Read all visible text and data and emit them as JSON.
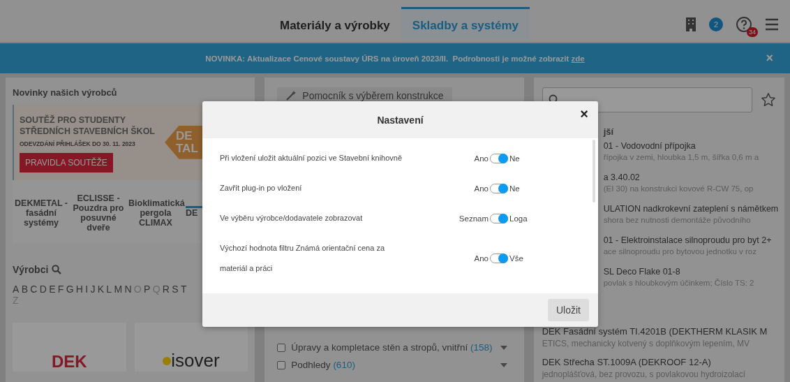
{
  "header": {
    "tabs": [
      {
        "label": "Materiály a výrobky",
        "selected": false
      },
      {
        "label": "Skladby a systémy",
        "selected": true
      }
    ],
    "notification_count": "2",
    "help_count": "34"
  },
  "banner": {
    "text": "NOVINKA: Aktualizace Cenové soustavy ÚRS na úroveň 2023/II.  Podrobnosti je možné zobrazit",
    "link": "zde",
    "close": "×"
  },
  "left_panel": {
    "heading": "Novinky našich výrobců",
    "promo": {
      "title": "SOUTĚŽ PRO STUDENTY STŘEDNÍCH STAVEBNÍCH ŠKOL",
      "subtitle": "ODEVZDÁNÍ PŘIHLÁŠEK DO 30. 11. 2023",
      "button": "PRAVIDLA SOUTĚŽE",
      "logo_lines": [
        "DE",
        "TAL"
      ]
    },
    "brands": [
      {
        "label": "DEKMETAL - fasádní systémy",
        "selected": false
      },
      {
        "label": "ECLISSE - Pouzdra pro posuvné dveře",
        "selected": false
      },
      {
        "label": "Bioklimatická pergola CLIMAX",
        "selected": false
      },
      {
        "label": "DE",
        "selected": true
      }
    ],
    "manufacturers_heading": "Výrobci",
    "alphabet_rows": [
      [
        {
          "letter": "A",
          "disabled": false
        },
        {
          "letter": "B",
          "disabled": false
        },
        {
          "letter": "C",
          "disabled": false
        },
        {
          "letter": "D",
          "disabled": false
        },
        {
          "letter": "E",
          "disabled": false
        },
        {
          "letter": "F",
          "disabled": false
        },
        {
          "letter": "G",
          "disabled": false
        },
        {
          "letter": "H",
          "disabled": false
        },
        {
          "letter": "I",
          "disabled": false
        },
        {
          "letter": "J",
          "disabled": false
        },
        {
          "letter": "K",
          "disabled": false
        },
        {
          "letter": "L",
          "disabled": false
        },
        {
          "letter": "M",
          "disabled": false
        },
        {
          "letter": "N",
          "disabled": false
        },
        {
          "letter": "O",
          "disabled": true
        },
        {
          "letter": "P",
          "disabled": false
        },
        {
          "letter": "Q",
          "disabled": true
        },
        {
          "letter": "R",
          "disabled": false
        },
        {
          "letter": "S",
          "disabled": false
        },
        {
          "letter": "T",
          "disabled": false
        }
      ],
      [
        {
          "letter": "Z",
          "disabled": true
        }
      ]
    ],
    "logos": [
      {
        "kind": "dek",
        "text": "DEK"
      },
      {
        "kind": "isover",
        "text": "isover"
      }
    ]
  },
  "middle_panel": {
    "helper_button": "Pomocník s výběrem konstrukce",
    "categories": [
      {
        "name": "Úpravy a kompletace stěn a stropů, vnitřní",
        "count": "(158)",
        "checked": false
      },
      {
        "name": "Podhledy",
        "count": "(610)",
        "checked": false
      }
    ]
  },
  "right_panel": {
    "section_heading": "jší",
    "partly_hidden_results": [
      {
        "title": "01 - Vodovodní přípojka",
        "description": "řípojka v zemi, hloubka 1,5 m, šířka 0,6 m a"
      },
      {
        "title": "a 3.40.02",
        "description": "(EI 30) na konstrukci kovové R-CW 75, op"
      },
      {
        "title": "ULATION nadkrokevní zateplení s námětkem",
        "description": "shora bez nutnosti demontáže původního"
      },
      {
        "title": "01 - Elektroinstalace silnoproudu pro byt 2+",
        "description": "ace silnoproudu pro bytovou jednotku v roz"
      },
      {
        "title": "SL Deco Flake 01-8",
        "description": "povlak s hloubkovým účinkem; Číslo TS: 2"
      }
    ],
    "results": [
      {
        "title": "DEK Fasádní systém TI.4201B (DEKTHERM KLASIK M",
        "description": "ETICS, mechanicky kotvený s doplňkovým lepením, MV"
      },
      {
        "title": "DEK Střecha ST.1009A (DEKROOF 12-A)",
        "description": "jednoplášťová, bez provozu, s povlakovou hydroizolací"
      }
    ]
  },
  "dialog": {
    "title": "Nastavení",
    "close": "×",
    "settings": [
      {
        "label": "Při vložení uložit aktuální pozici ve Stavební knihovně",
        "left_option": "Ano",
        "right_option": "Ne",
        "on": true
      },
      {
        "label": "Zavřít plug-in po vložení",
        "left_option": "Ano",
        "right_option": "Ne",
        "on": true
      },
      {
        "label": "Ve výběru výrobce/dodavatele zobrazovat",
        "left_option": "Seznam",
        "right_option": "Loga",
        "on": true
      },
      {
        "label": "Výchozí hodnota filtru Známá orientační cena za materiál a práci",
        "left_option": "Ano",
        "right_option": "Vše",
        "on": true
      }
    ],
    "save_button": "Uložit"
  }
}
